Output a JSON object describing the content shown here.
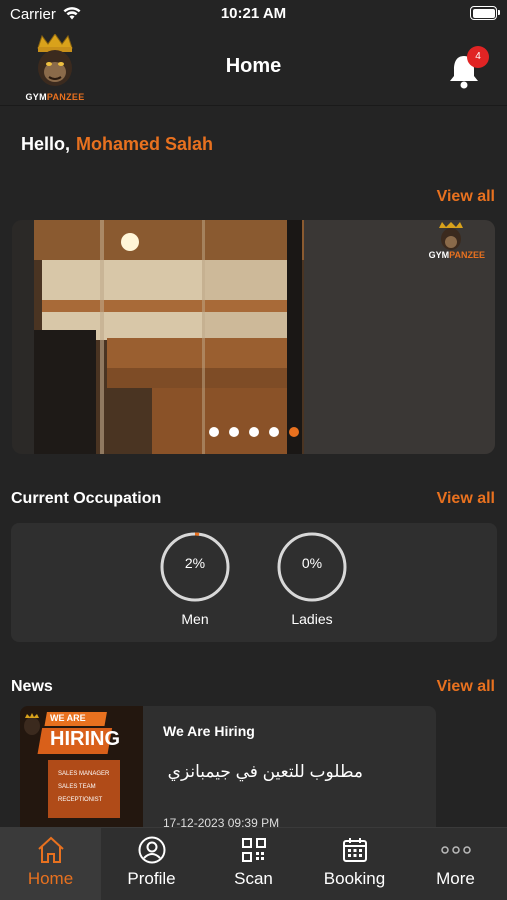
{
  "status_bar": {
    "carrier": "Carrier",
    "time": "10:21 AM"
  },
  "header": {
    "title": "Home",
    "logo_text_a": "GYM",
    "logo_text_b": "PANZEE",
    "notification_count": "4"
  },
  "greeting": {
    "hello": "Hello,",
    "user_name": "Mohamed Salah"
  },
  "banner": {
    "view_all": "View all",
    "slide_count": 5,
    "active_slide": 5,
    "logo_text_a": "GYM",
    "logo_text_b": "PANZEE"
  },
  "occupation": {
    "title": "Current Occupation",
    "view_all": "View all",
    "gauges": [
      {
        "label": "Men",
        "value_text": "2%",
        "percent": 2
      },
      {
        "label": "Ladies",
        "value_text": "0%",
        "percent": 0
      }
    ]
  },
  "news": {
    "title": "News",
    "view_all": "View all",
    "items": [
      {
        "heading": "We Are Hiring",
        "body": "مطلوب للتعين في جيمبانزي",
        "date": "17-12-2023 09:39 PM",
        "image_text_a": "WE ARE",
        "image_text_b": "HIRING",
        "image_lines": [
          "SALES MANAGER",
          "SALES TEAM",
          "RECEPTIONIST"
        ]
      }
    ]
  },
  "tabbar": {
    "tabs": [
      {
        "label": "Home",
        "icon": "home-icon",
        "active": true
      },
      {
        "label": "Profile",
        "icon": "profile-icon",
        "active": false
      },
      {
        "label": "Scan",
        "icon": "qr-code-icon",
        "active": false
      },
      {
        "label": "Booking",
        "icon": "calendar-icon",
        "active": false
      },
      {
        "label": "More",
        "icon": "more-dots-icon",
        "active": false
      }
    ]
  },
  "colors": {
    "accent": "#e8711f",
    "background": "#242424",
    "card": "#2f2f2f",
    "badge": "#e02424"
  }
}
